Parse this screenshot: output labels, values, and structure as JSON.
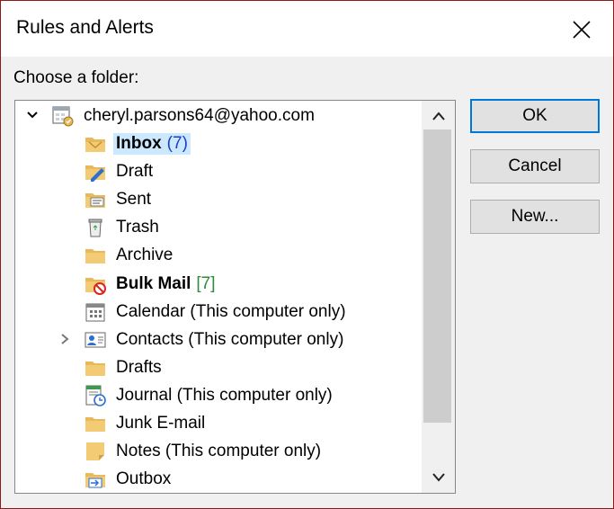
{
  "window": {
    "title": "Rules and Alerts"
  },
  "prompt": "Choose a folder:",
  "tree": {
    "account": "cheryl.parsons64@yahoo.com",
    "folders": [
      {
        "name": "Inbox",
        "count": "(7)",
        "count_style": "blue",
        "bold": true,
        "selected": true,
        "icon": "inbox-folder-icon"
      },
      {
        "name": "Draft",
        "icon": "draft-folder-icon"
      },
      {
        "name": "Sent",
        "icon": "sent-folder-icon"
      },
      {
        "name": "Trash",
        "icon": "trash-icon"
      },
      {
        "name": "Archive",
        "icon": "archive-folder-icon"
      },
      {
        "name": "Bulk Mail",
        "count": "[7]",
        "count_style": "green",
        "bold": true,
        "icon": "bulk-mail-folder-icon"
      },
      {
        "name": "Calendar (This computer only)",
        "icon": "calendar-icon"
      },
      {
        "name": "Contacts (This computer only)",
        "icon": "contacts-icon",
        "expandable": true
      },
      {
        "name": "Drafts",
        "icon": "drafts-folder-icon"
      },
      {
        "name": "Journal (This computer only)",
        "icon": "journal-icon"
      },
      {
        "name": "Junk E-mail",
        "icon": "junk-folder-icon"
      },
      {
        "name": "Notes (This computer only)",
        "icon": "notes-icon"
      },
      {
        "name": "Outbox",
        "icon": "outbox-folder-icon"
      }
    ]
  },
  "buttons": {
    "ok": "OK",
    "cancel": "Cancel",
    "new": "New..."
  },
  "colors": {
    "selection": "#cce8ff",
    "default_border": "#0078d7",
    "count_blue": "#1a3ec8",
    "count_green": "#2e8b3a",
    "folder": "#e8b85a"
  }
}
